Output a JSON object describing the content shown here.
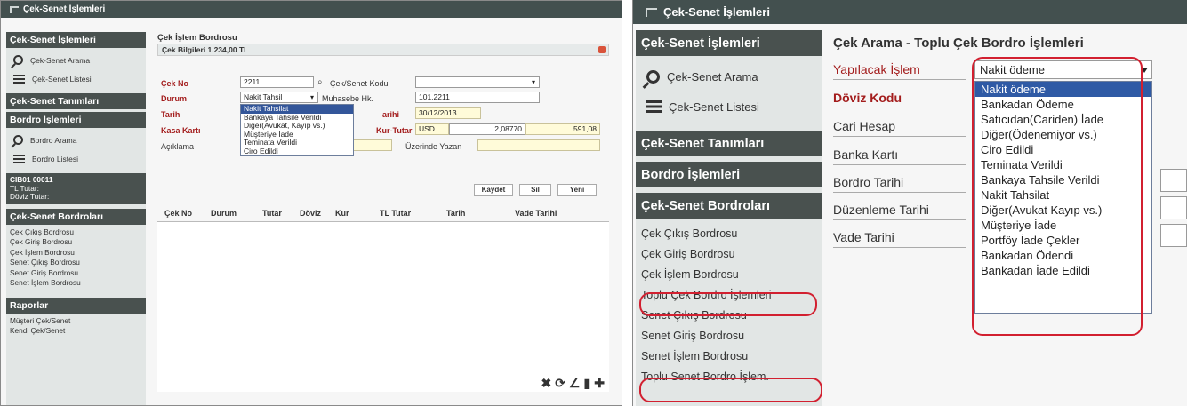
{
  "panel1": {
    "title": "Çek-Senet İşlemleri",
    "sidebar": {
      "header1": "Çek-Senet İşlemleri",
      "item_search": "Çek-Senet Arama",
      "item_list": "Çek-Senet Listesi",
      "header2": "Çek-Senet Tanımları",
      "header3": "Bordro İşlemleri",
      "item_bsearch": "Bordro Arama",
      "item_blist": "Bordro Listesi",
      "info_code": "CIB01 00011",
      "info_tl": "TL Tutar:",
      "info_doviz": "Döviz Tutar:",
      "header4": "Çek-Senet Bordroları",
      "links": [
        "Çek Çıkış Bordrosu",
        "Çek Giriş Bordrosu",
        "Çek İşlem Bordrosu",
        "Senet Çıkış Bordrosu",
        "Senet Giriş Bordrosu",
        "Senet İşlem Bordrosu"
      ],
      "header5": "Raporlar",
      "reports": [
        "Müşteri Çek/Senet",
        "Kendi Çek/Senet"
      ]
    },
    "main": {
      "title": "Çek İşlem Bordrosu",
      "subtitle": "Çek Bilgileri  1.234,00 TL",
      "cek_no_label": "Çek No",
      "cek_no_value": "2211",
      "cek_senet_kodu_label": "Çek/Senet Kodu",
      "durum_label": "Durum",
      "durum_value": "Nakit Tahsil",
      "muhasebe_label": "Muhasebe Hk.",
      "muhasebe_value": "101.2211",
      "tarih_label": "Tarih",
      "tarih_suffix": "arihi",
      "tarih_value": "30/12/2013",
      "kasa_label": "Kasa Kartı",
      "kur_label": "Kur-Tutar",
      "kur_currency": "USD",
      "kur_rate": "2,08770",
      "kur_amount": "591,08",
      "aciklama_label": "Açıklama",
      "uzerinde_label": "Üzerinde Yazan",
      "btn_kaydet": "Kaydet",
      "btn_sil": "Sil",
      "btn_yeni": "Yeni",
      "columns": [
        "Çek No",
        "Durum",
        "Tutar",
        "Döviz",
        "Kur",
        "TL Tutar",
        "Tarih",
        "Vade Tarihi"
      ],
      "dropdown": [
        "Nakit Tahsilat",
        "Bankaya Tahsile Verildi",
        "Diğer(Avukat, Kayıp vs.)",
        "Müşteriye İade",
        "Teminata Verildi",
        "Ciro Edildi"
      ],
      "toolbar_icons": "✖⟳∠▮✚"
    }
  },
  "panel2": {
    "title": "Çek-Senet İşlemleri",
    "sidebar": {
      "header1": "Çek-Senet İşlemleri",
      "item_search": "Çek-Senet Arama",
      "item_list": "Çek-Senet Listesi",
      "header2": "Çek-Senet Tanımları",
      "header3": "Bordro İşlemleri",
      "header4": "Çek-Senet Bordroları",
      "links": [
        "Çek Çıkış Bordrosu",
        "Çek Giriş Bordrosu",
        "Çek İşlem Bordrosu",
        "Toplu Çek Bordro İşlemleri",
        "Senet Çıkış Bordrosu",
        "Senet Giriş Bordrosu",
        "Senet İşlem Bordrosu",
        "Toplu Senet Bordro İşlem."
      ]
    },
    "main": {
      "title": "Çek Arama - Toplu Çek Bordro İşlemleri",
      "fields": [
        "Yapılacak İşlem",
        "Döviz Kodu",
        "Cari Hesap",
        "Banka Kartı",
        "Bordro Tarihi",
        "Düzenleme Tarihi",
        "Vade Tarihi"
      ],
      "select_value": "Nakit ödeme",
      "dropdown": [
        "Nakit ödeme",
        "Bankadan Ödeme",
        "Satıcıdan(Cariden) İade",
        "Diğer(Ödenemiyor vs.)",
        "Ciro Edildi",
        "Teminata Verildi",
        "Bankaya Tahsile Verildi",
        "Nakit Tahsilat",
        "Diğer(Avukat Kayıp vs.)",
        "Müşteriye İade",
        "Portföy İade Çekler",
        "Bankadan Ödendi",
        "Bankadan İade Edildi"
      ]
    }
  },
  "colors": {
    "header_bg": "#49514f",
    "accent_red": "#d22030",
    "selected_blue": "#2f5aa5",
    "label_red": "#a31c1c"
  }
}
